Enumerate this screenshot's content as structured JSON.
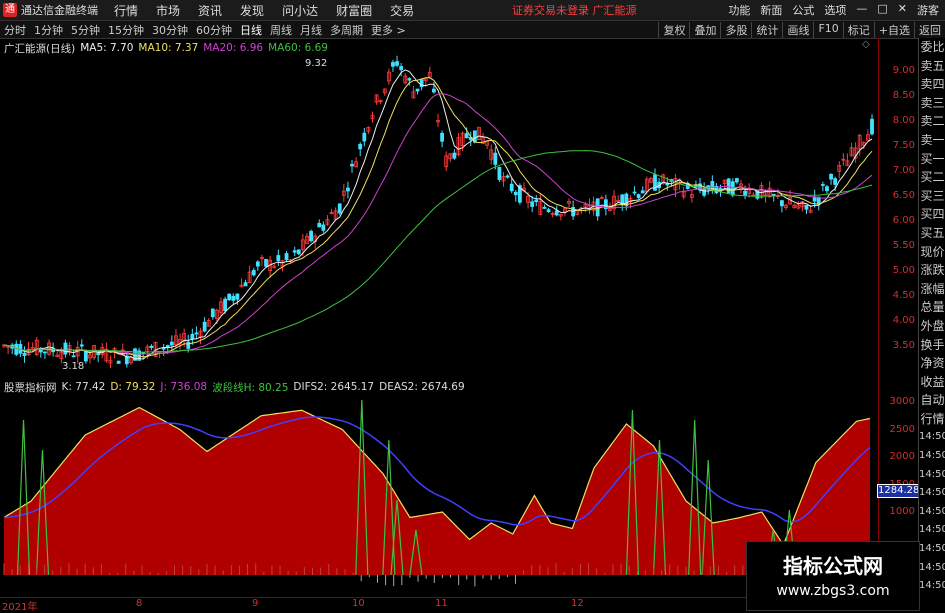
{
  "app": {
    "logo_text": "通",
    "title": "通达信金融终端"
  },
  "menu": [
    "行情",
    "市场",
    "资讯",
    "发现",
    "问小达",
    "财富圈",
    "交易"
  ],
  "notice": "证券交易未登录  广汇能源",
  "right_tools": [
    "功能",
    "新面",
    "公式",
    "选项",
    "—",
    "□",
    "✕",
    "游客"
  ],
  "periods": [
    "分时",
    "1分钟",
    "5分钟",
    "15分钟",
    "30分钟",
    "60分钟",
    "日线",
    "周线",
    "月线",
    "多周期",
    "更多 >"
  ],
  "chart_tools": [
    "复权",
    "叠加",
    "多股",
    "统计",
    "画线",
    "F10",
    "标记",
    "+自选",
    "返回"
  ],
  "main_legend": {
    "title": "广汇能源(日线)",
    "ma5": "MA5: 7.70",
    "ma10": "MA10: 7.37",
    "ma20": "MA20: 6.96",
    "ma60": "MA60: 6.69"
  },
  "sub_legend": {
    "title": "股票指标网",
    "k": "K: 77.42",
    "d": "D: 79.32",
    "j": "J: 736.08",
    "h": "波段线H: 80.25",
    "difs": "DIFS2: 2645.17",
    "deas": "DEAS2: 2674.69"
  },
  "annotations": {
    "high": "9.32",
    "low": "3.18"
  },
  "price_axis": [
    "9.00",
    "8.50",
    "8.00",
    "7.50",
    "7.00",
    "6.50",
    "6.00",
    "5.50",
    "5.00",
    "4.50",
    "4.00",
    "3.50"
  ],
  "sub_axis": [
    "3000",
    "2500",
    "2000",
    "1500",
    "1000"
  ],
  "crosshair_value": "1284.28",
  "date_axis": [
    "2021年",
    "8",
    "9",
    "10",
    "11",
    "12"
  ],
  "sidebar": [
    "委比",
    "卖五",
    "卖四",
    "卖三",
    "卖二",
    "卖一",
    "买一",
    "买二",
    "买三",
    "买四",
    "买五",
    "现价",
    "涨跌",
    "涨幅",
    "总量",
    "外盘",
    "换手",
    "净资",
    "收益",
    "自动",
    "行情",
    "14:50",
    "14:50",
    "14:50",
    "14:50",
    "14:50",
    "14:50",
    "14:50",
    "14:50",
    "14:50"
  ],
  "watermark": {
    "line1": "指标公式网",
    "line2": "www.zbgs3.com"
  },
  "colors": {
    "up": "#ff3a3a",
    "down": "#40e0ff",
    "ma5": "#f0f0f0",
    "ma10": "#f0e060",
    "ma20": "#d040d0",
    "ma60": "#40c040",
    "fill": "#b00000",
    "difs": "#f0e060",
    "deas": "#4040ff"
  }
}
